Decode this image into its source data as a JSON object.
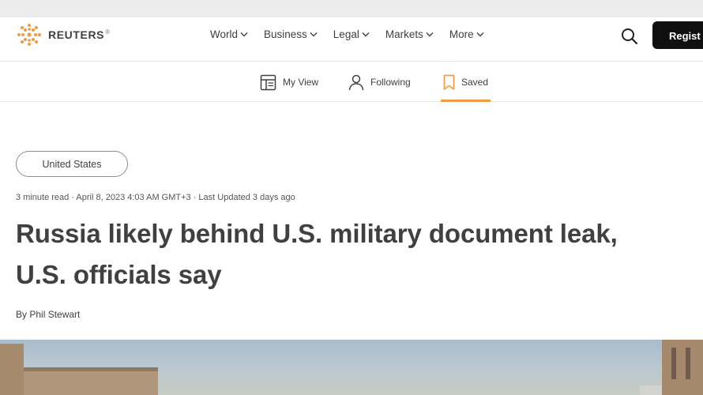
{
  "header": {
    "brand": "REUTERS",
    "brand_mark": "®",
    "nav": [
      "World",
      "Business",
      "Legal",
      "Markets",
      "More"
    ],
    "register_label": "Regist"
  },
  "subnav": {
    "my_view": "My View",
    "following": "Following",
    "saved": "Saved"
  },
  "article": {
    "tag": "United States",
    "meta": "3 minute read · April 8, 2023 4:03 AM GMT+3 · Last Updated 3 days ago",
    "title_line1": "Russia likely behind U.S. military document leak,",
    "title_line2": "U.S. officials say",
    "byline_prefix": "By ",
    "author": "Phil Stewart"
  },
  "colors": {
    "brand_orange": "#f19b48",
    "text": "#404040",
    "register_bg": "#101010"
  },
  "icons": {
    "logo": "reuters-logo-icon",
    "search": "search-icon",
    "chevron": "chevron-down-icon",
    "my_view": "layout-icon",
    "following": "person-icon",
    "saved": "bookmark-icon"
  }
}
